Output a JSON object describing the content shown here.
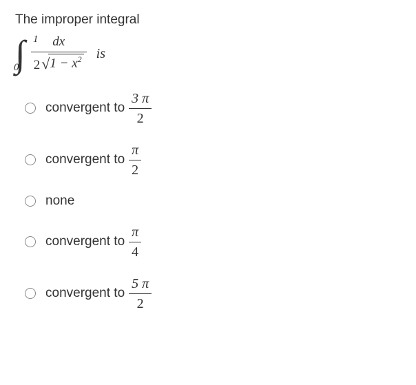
{
  "question": {
    "stem": "The improper integral",
    "is_word": "is",
    "integral": {
      "lower": "0",
      "upper": "1",
      "numerator": "dx",
      "denom_coeff": "2",
      "radicand_pre": "1 − x",
      "radicand_exp": "2"
    }
  },
  "options": [
    {
      "text": "convergent to",
      "frac_num": "3 π",
      "frac_den": "2"
    },
    {
      "text": "convergent to",
      "frac_num": "π",
      "frac_den": "2"
    },
    {
      "text": "none"
    },
    {
      "text": "convergent to",
      "frac_num": "π",
      "frac_den": "4"
    },
    {
      "text": "convergent to",
      "frac_num": "5 π",
      "frac_den": "2"
    }
  ]
}
